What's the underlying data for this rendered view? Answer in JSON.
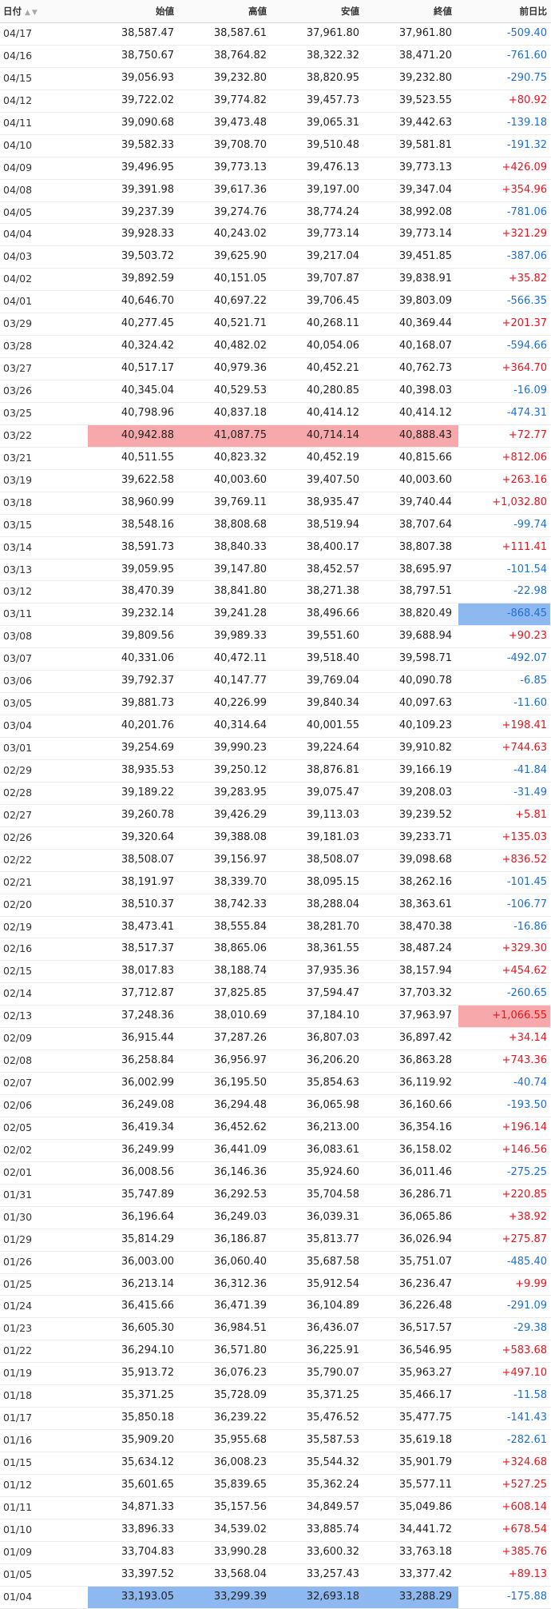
{
  "headers": {
    "date": "日付",
    "sort_asc": "▲",
    "sort_desc": "▼",
    "open": "始値",
    "high": "高値",
    "low": "安値",
    "close": "終値",
    "change": "前日比"
  },
  "colors": {
    "positive": "#e8141e",
    "negative": "#1f6fd1",
    "highlight_high": "#f7a8ab",
    "highlight_low": "#8eb8f0"
  },
  "rows": [
    {
      "date": "04/17",
      "open": "38,587.47",
      "high": "38,587.61",
      "low": "37,961.80",
      "close": "37,961.80",
      "change": "-509.40"
    },
    {
      "date": "04/16",
      "open": "38,750.67",
      "high": "38,764.82",
      "low": "38,322.32",
      "close": "38,471.20",
      "change": "-761.60"
    },
    {
      "date": "04/15",
      "open": "39,056.93",
      "high": "39,232.80",
      "low": "38,820.95",
      "close": "39,232.80",
      "change": "-290.75"
    },
    {
      "date": "04/12",
      "open": "39,722.02",
      "high": "39,774.82",
      "low": "39,457.73",
      "close": "39,523.55",
      "change": "+80.92"
    },
    {
      "date": "04/11",
      "open": "39,090.68",
      "high": "39,473.48",
      "low": "39,065.31",
      "close": "39,442.63",
      "change": "-139.18"
    },
    {
      "date": "04/10",
      "open": "39,582.33",
      "high": "39,708.70",
      "low": "39,510.48",
      "close": "39,581.81",
      "change": "-191.32"
    },
    {
      "date": "04/09",
      "open": "39,496.95",
      "high": "39,773.13",
      "low": "39,476.13",
      "close": "39,773.13",
      "change": "+426.09"
    },
    {
      "date": "04/08",
      "open": "39,391.98",
      "high": "39,617.36",
      "low": "39,197.00",
      "close": "39,347.04",
      "change": "+354.96"
    },
    {
      "date": "04/05",
      "open": "39,237.39",
      "high": "39,274.76",
      "low": "38,774.24",
      "close": "38,992.08",
      "change": "-781.06"
    },
    {
      "date": "04/04",
      "open": "39,928.33",
      "high": "40,243.02",
      "low": "39,773.14",
      "close": "39,773.14",
      "change": "+321.29"
    },
    {
      "date": "04/03",
      "open": "39,503.72",
      "high": "39,625.90",
      "low": "39,217.04",
      "close": "39,451.85",
      "change": "-387.06"
    },
    {
      "date": "04/02",
      "open": "39,892.59",
      "high": "40,151.05",
      "low": "39,707.87",
      "close": "39,838.91",
      "change": "+35.82"
    },
    {
      "date": "04/01",
      "open": "40,646.70",
      "high": "40,697.22",
      "low": "39,706.45",
      "close": "39,803.09",
      "change": "-566.35"
    },
    {
      "date": "03/29",
      "open": "40,277.45",
      "high": "40,521.71",
      "low": "40,268.11",
      "close": "40,369.44",
      "change": "+201.37"
    },
    {
      "date": "03/28",
      "open": "40,324.42",
      "high": "40,482.02",
      "low": "40,054.06",
      "close": "40,168.07",
      "change": "-594.66"
    },
    {
      "date": "03/27",
      "open": "40,517.17",
      "high": "40,979.36",
      "low": "40,452.21",
      "close": "40,762.73",
      "change": "+364.70"
    },
    {
      "date": "03/26",
      "open": "40,345.04",
      "high": "40,529.53",
      "low": "40,280.85",
      "close": "40,398.03",
      "change": "-16.09"
    },
    {
      "date": "03/25",
      "open": "40,798.96",
      "high": "40,837.18",
      "low": "40,414.12",
      "close": "40,414.12",
      "change": "-474.31"
    },
    {
      "date": "03/22",
      "open": "40,942.88",
      "high": "41,087.75",
      "low": "40,714.14",
      "close": "40,888.43",
      "change": "+72.77",
      "hl": "hl-red",
      "hl_cols": "ohlc"
    },
    {
      "date": "03/21",
      "open": "40,511.55",
      "high": "40,823.32",
      "low": "40,452.19",
      "close": "40,815.66",
      "change": "+812.06"
    },
    {
      "date": "03/19",
      "open": "39,622.58",
      "high": "40,003.60",
      "low": "39,407.50",
      "close": "40,003.60",
      "change": "+263.16"
    },
    {
      "date": "03/18",
      "open": "38,960.99",
      "high": "39,769.11",
      "low": "38,935.47",
      "close": "39,740.44",
      "change": "+1,032.80"
    },
    {
      "date": "03/15",
      "open": "38,548.16",
      "high": "38,808.68",
      "low": "38,519.94",
      "close": "38,707.64",
      "change": "-99.74"
    },
    {
      "date": "03/14",
      "open": "38,591.73",
      "high": "38,840.33",
      "low": "38,400.17",
      "close": "38,807.38",
      "change": "+111.41"
    },
    {
      "date": "03/13",
      "open": "39,059.95",
      "high": "39,147.80",
      "low": "38,452.57",
      "close": "38,695.97",
      "change": "-101.54"
    },
    {
      "date": "03/12",
      "open": "38,470.39",
      "high": "38,841.80",
      "low": "38,271.38",
      "close": "38,797.51",
      "change": "-22.98"
    },
    {
      "date": "03/11",
      "open": "39,232.14",
      "high": "39,241.28",
      "low": "38,496.66",
      "close": "38,820.49",
      "change": "-868.45",
      "hl": "hl-blue",
      "hl_cols": "chg"
    },
    {
      "date": "03/08",
      "open": "39,809.56",
      "high": "39,989.33",
      "low": "39,551.60",
      "close": "39,688.94",
      "change": "+90.23"
    },
    {
      "date": "03/07",
      "open": "40,331.06",
      "high": "40,472.11",
      "low": "39,518.40",
      "close": "39,598.71",
      "change": "-492.07"
    },
    {
      "date": "03/06",
      "open": "39,792.37",
      "high": "40,147.77",
      "low": "39,769.04",
      "close": "40,090.78",
      "change": "-6.85"
    },
    {
      "date": "03/05",
      "open": "39,881.73",
      "high": "40,226.99",
      "low": "39,840.34",
      "close": "40,097.63",
      "change": "-11.60"
    },
    {
      "date": "03/04",
      "open": "40,201.76",
      "high": "40,314.64",
      "low": "40,001.55",
      "close": "40,109.23",
      "change": "+198.41"
    },
    {
      "date": "03/01",
      "open": "39,254.69",
      "high": "39,990.23",
      "low": "39,224.64",
      "close": "39,910.82",
      "change": "+744.63"
    },
    {
      "date": "02/29",
      "open": "38,935.53",
      "high": "39,250.12",
      "low": "38,876.81",
      "close": "39,166.19",
      "change": "-41.84"
    },
    {
      "date": "02/28",
      "open": "39,189.22",
      "high": "39,283.95",
      "low": "39,075.47",
      "close": "39,208.03",
      "change": "-31.49"
    },
    {
      "date": "02/27",
      "open": "39,260.78",
      "high": "39,426.29",
      "low": "39,113.03",
      "close": "39,239.52",
      "change": "+5.81"
    },
    {
      "date": "02/26",
      "open": "39,320.64",
      "high": "39,388.08",
      "low": "39,181.03",
      "close": "39,233.71",
      "change": "+135.03"
    },
    {
      "date": "02/22",
      "open": "38,508.07",
      "high": "39,156.97",
      "low": "38,508.07",
      "close": "39,098.68",
      "change": "+836.52"
    },
    {
      "date": "02/21",
      "open": "38,191.97",
      "high": "38,339.70",
      "low": "38,095.15",
      "close": "38,262.16",
      "change": "-101.45"
    },
    {
      "date": "02/20",
      "open": "38,510.37",
      "high": "38,742.33",
      "low": "38,288.04",
      "close": "38,363.61",
      "change": "-106.77"
    },
    {
      "date": "02/19",
      "open": "38,473.41",
      "high": "38,555.84",
      "low": "38,281.70",
      "close": "38,470.38",
      "change": "-16.86"
    },
    {
      "date": "02/16",
      "open": "38,517.37",
      "high": "38,865.06",
      "low": "38,361.55",
      "close": "38,487.24",
      "change": "+329.30"
    },
    {
      "date": "02/15",
      "open": "38,017.83",
      "high": "38,188.74",
      "low": "37,935.36",
      "close": "38,157.94",
      "change": "+454.62"
    },
    {
      "date": "02/14",
      "open": "37,712.87",
      "high": "37,825.85",
      "low": "37,594.47",
      "close": "37,703.32",
      "change": "-260.65"
    },
    {
      "date": "02/13",
      "open": "37,248.36",
      "high": "38,010.69",
      "low": "37,184.10",
      "close": "37,963.97",
      "change": "+1,066.55",
      "hl": "hl-red",
      "hl_cols": "chg"
    },
    {
      "date": "02/09",
      "open": "36,915.44",
      "high": "37,287.26",
      "low": "36,807.03",
      "close": "36,897.42",
      "change": "+34.14"
    },
    {
      "date": "02/08",
      "open": "36,258.84",
      "high": "36,956.97",
      "low": "36,206.20",
      "close": "36,863.28",
      "change": "+743.36"
    },
    {
      "date": "02/07",
      "open": "36,002.99",
      "high": "36,195.50",
      "low": "35,854.63",
      "close": "36,119.92",
      "change": "-40.74"
    },
    {
      "date": "02/06",
      "open": "36,249.08",
      "high": "36,294.48",
      "low": "36,065.98",
      "close": "36,160.66",
      "change": "-193.50"
    },
    {
      "date": "02/05",
      "open": "36,419.34",
      "high": "36,452.62",
      "low": "36,213.00",
      "close": "36,354.16",
      "change": "+196.14"
    },
    {
      "date": "02/02",
      "open": "36,249.99",
      "high": "36,441.09",
      "low": "36,083.61",
      "close": "36,158.02",
      "change": "+146.56"
    },
    {
      "date": "02/01",
      "open": "36,008.56",
      "high": "36,146.36",
      "low": "35,924.60",
      "close": "36,011.46",
      "change": "-275.25"
    },
    {
      "date": "01/31",
      "open": "35,747.89",
      "high": "36,292.53",
      "low": "35,704.58",
      "close": "36,286.71",
      "change": "+220.85"
    },
    {
      "date": "01/30",
      "open": "36,196.64",
      "high": "36,249.03",
      "low": "36,039.31",
      "close": "36,065.86",
      "change": "+38.92"
    },
    {
      "date": "01/29",
      "open": "35,814.29",
      "high": "36,186.87",
      "low": "35,813.77",
      "close": "36,026.94",
      "change": "+275.87"
    },
    {
      "date": "01/26",
      "open": "36,003.00",
      "high": "36,060.40",
      "low": "35,687.58",
      "close": "35,751.07",
      "change": "-485.40"
    },
    {
      "date": "01/25",
      "open": "36,213.14",
      "high": "36,312.36",
      "low": "35,912.54",
      "close": "36,236.47",
      "change": "+9.99"
    },
    {
      "date": "01/24",
      "open": "36,415.66",
      "high": "36,471.39",
      "low": "36,104.89",
      "close": "36,226.48",
      "change": "-291.09"
    },
    {
      "date": "01/23",
      "open": "36,605.30",
      "high": "36,984.51",
      "low": "36,436.07",
      "close": "36,517.57",
      "change": "-29.38"
    },
    {
      "date": "01/22",
      "open": "36,294.10",
      "high": "36,571.80",
      "low": "36,225.91",
      "close": "36,546.95",
      "change": "+583.68"
    },
    {
      "date": "01/19",
      "open": "35,913.72",
      "high": "36,076.23",
      "low": "35,790.07",
      "close": "35,963.27",
      "change": "+497.10"
    },
    {
      "date": "01/18",
      "open": "35,371.25",
      "high": "35,728.09",
      "low": "35,371.25",
      "close": "35,466.17",
      "change": "-11.58"
    },
    {
      "date": "01/17",
      "open": "35,850.18",
      "high": "36,239.22",
      "low": "35,476.52",
      "close": "35,477.75",
      "change": "-141.43"
    },
    {
      "date": "01/16",
      "open": "35,909.20",
      "high": "35,955.68",
      "low": "35,587.53",
      "close": "35,619.18",
      "change": "-282.61"
    },
    {
      "date": "01/15",
      "open": "35,634.12",
      "high": "36,008.23",
      "low": "35,544.32",
      "close": "35,901.79",
      "change": "+324.68"
    },
    {
      "date": "01/12",
      "open": "35,601.65",
      "high": "35,839.65",
      "low": "35,362.24",
      "close": "35,577.11",
      "change": "+527.25"
    },
    {
      "date": "01/11",
      "open": "34,871.33",
      "high": "35,157.56",
      "low": "34,849.57",
      "close": "35,049.86",
      "change": "+608.14"
    },
    {
      "date": "01/10",
      "open": "33,896.33",
      "high": "34,539.02",
      "low": "33,885.74",
      "close": "34,441.72",
      "change": "+678.54"
    },
    {
      "date": "01/09",
      "open": "33,704.83",
      "high": "33,990.28",
      "low": "33,600.32",
      "close": "33,763.18",
      "change": "+385.76"
    },
    {
      "date": "01/05",
      "open": "33,397.52",
      "high": "33,568.04",
      "low": "33,257.43",
      "close": "33,377.42",
      "change": "+89.13"
    },
    {
      "date": "01/04",
      "open": "33,193.05",
      "high": "33,299.39",
      "low": "32,693.18",
      "close": "33,288.29",
      "change": "-175.88",
      "hl": "hl-blue",
      "hl_cols": "ohlc"
    }
  ]
}
